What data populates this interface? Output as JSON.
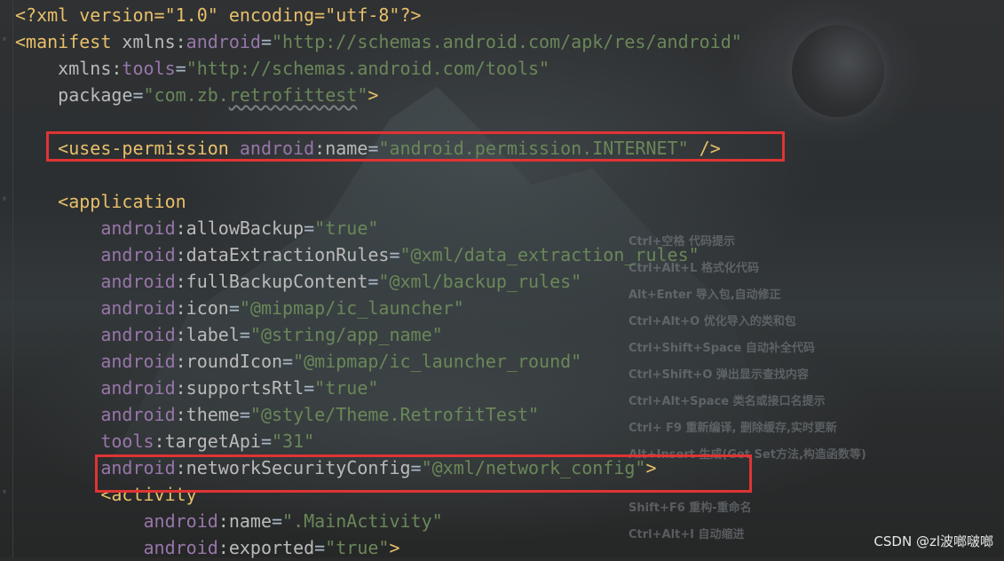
{
  "code_lines": [
    [
      [
        "<?xml version=\"1.0\" encoding=\"utf-8\"?>",
        "c-decl"
      ]
    ],
    [
      [
        "<manifest ",
        "c-tag"
      ],
      [
        "xmlns:",
        "c-attr"
      ],
      [
        "android",
        "c-ns"
      ],
      [
        "=",
        "c-txt"
      ],
      [
        "\"http://schemas.android.com/apk/res/android\"",
        "c-str"
      ]
    ],
    [
      [
        "    xmlns:",
        "c-attr"
      ],
      [
        "tools",
        "c-ns"
      ],
      [
        "=",
        "c-txt"
      ],
      [
        "\"http://schemas.android.com/tools\"",
        "c-str"
      ]
    ],
    [
      [
        "    package",
        "c-attr"
      ],
      [
        "=",
        "c-txt"
      ],
      [
        "\"com.zb.",
        "c-str"
      ],
      [
        "retrofittest",
        "c-str squiggle"
      ],
      [
        "\"",
        "c-str"
      ],
      [
        ">",
        "c-tag"
      ]
    ],
    [],
    [
      [
        "    <uses-permission ",
        "c-tag"
      ],
      [
        "android",
        "c-ns"
      ],
      [
        ":name",
        "c-attr"
      ],
      [
        "=",
        "c-txt"
      ],
      [
        "\"android.permission.INTERNET\"",
        "c-str"
      ],
      [
        " />",
        "c-tag"
      ]
    ],
    [],
    [
      [
        "    <application",
        "c-tag"
      ]
    ],
    [
      [
        "        android",
        "c-ns"
      ],
      [
        ":allowBackup",
        "c-attr"
      ],
      [
        "=",
        "c-txt"
      ],
      [
        "\"true\"",
        "c-str"
      ]
    ],
    [
      [
        "        android",
        "c-ns"
      ],
      [
        ":dataExtractionRules",
        "c-attr"
      ],
      [
        "=",
        "c-txt"
      ],
      [
        "\"@xml/data_extraction_rules\"",
        "c-str"
      ]
    ],
    [
      [
        "        android",
        "c-ns"
      ],
      [
        ":fullBackupContent",
        "c-attr"
      ],
      [
        "=",
        "c-txt"
      ],
      [
        "\"@xml/backup_rules\"",
        "c-str"
      ]
    ],
    [
      [
        "        android",
        "c-ns"
      ],
      [
        ":icon",
        "c-attr"
      ],
      [
        "=",
        "c-txt"
      ],
      [
        "\"@mipmap/ic_launcher\"",
        "c-str"
      ]
    ],
    [
      [
        "        android",
        "c-ns"
      ],
      [
        ":label",
        "c-attr"
      ],
      [
        "=",
        "c-txt"
      ],
      [
        "\"@string/app_name\"",
        "c-str"
      ]
    ],
    [
      [
        "        android",
        "c-ns"
      ],
      [
        ":roundIcon",
        "c-attr"
      ],
      [
        "=",
        "c-txt"
      ],
      [
        "\"@mipmap/ic_launcher_round\"",
        "c-str"
      ]
    ],
    [
      [
        "        android",
        "c-ns"
      ],
      [
        ":supportsRtl",
        "c-attr"
      ],
      [
        "=",
        "c-txt"
      ],
      [
        "\"true\"",
        "c-str"
      ]
    ],
    [
      [
        "        android",
        "c-ns"
      ],
      [
        ":theme",
        "c-attr"
      ],
      [
        "=",
        "c-txt"
      ],
      [
        "\"@style/Theme.RetrofitTest\"",
        "c-str"
      ]
    ],
    [
      [
        "        tools",
        "c-ns"
      ],
      [
        ":targetApi",
        "c-attr"
      ],
      [
        "=",
        "c-txt"
      ],
      [
        "\"31\"",
        "c-str"
      ]
    ],
    [
      [
        "        android",
        "c-ns"
      ],
      [
        ":networkSecurityConfig",
        "c-attr"
      ],
      [
        "=",
        "c-txt"
      ],
      [
        "\"@xml/network_config\"",
        "c-str"
      ],
      [
        ">",
        "c-tag"
      ]
    ],
    [
      [
        "        <activity",
        "c-tag"
      ]
    ],
    [
      [
        "            android",
        "c-ns"
      ],
      [
        ":name",
        "c-attr"
      ],
      [
        "=",
        "c-txt"
      ],
      [
        "\".MainActivity\"",
        "c-str"
      ]
    ],
    [
      [
        "            android",
        "c-ns"
      ],
      [
        ":exported",
        "c-attr"
      ],
      [
        "=",
        "c-txt"
      ],
      [
        "\"true\"",
        "c-str"
      ],
      [
        ">",
        "c-tag"
      ]
    ]
  ],
  "background_shortcut_hints": [
    "Ctrl+空格  代码提示",
    "Ctrl+Alt+L  格式化代码",
    "Alt+Enter 导入包,自动修正",
    "Ctrl+Alt+O  优化导入的类和包",
    "Ctrl+Shift+Space 自动补全代码",
    "Ctrl+Shift+O  弹出显示查找内容",
    "Ctrl+Alt+Space  类名或接口名提示",
    " Ctrl+ F9 重新编译, 删除缓存,实时更新",
    "Alt+Insert  生成(Get Set方法,构造函数等)",
    "",
    "Shift+F6  重构-重命名",
    "Ctrl+Alt+I  自动缩进"
  ],
  "watermark": "CSDN @zl波啷啵啷",
  "colors": {
    "editor_bg": "#2b2b2b",
    "tag": "#e8bf6a",
    "namespace": "#9876aa",
    "attribute": "#bababa",
    "string": "#6a8759",
    "highlight_box": "#e03434"
  }
}
